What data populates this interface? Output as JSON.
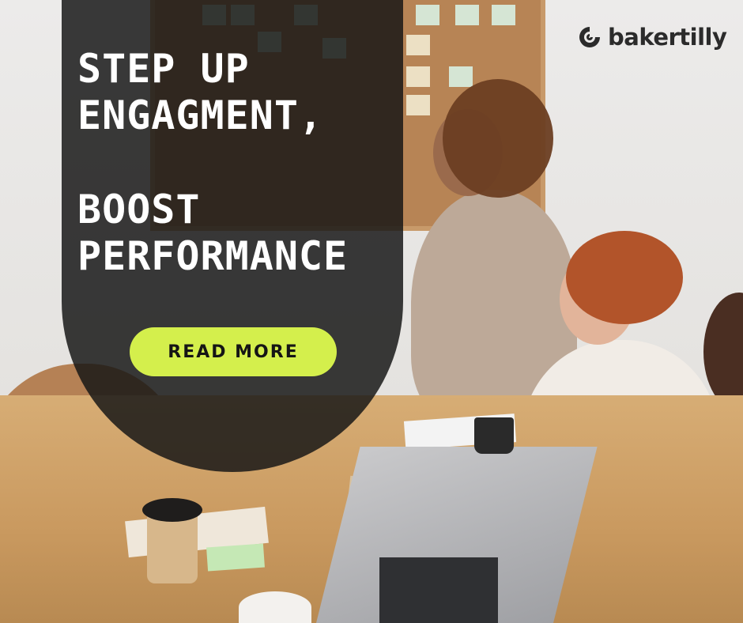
{
  "headline": {
    "line1": "STEP UP",
    "line2": "ENGAGMENT,",
    "line3": "BOOST",
    "line4": "PERFORMANCE"
  },
  "cta": {
    "label": "READ MORE"
  },
  "brand": {
    "name": "bakertilly",
    "logo_icon": "bakertilly-swirl-icon"
  },
  "colors": {
    "cta_background": "#d4ef4c",
    "panel_overlay": "#161616",
    "headline_text": "#ffffff",
    "logo_text": "#2b2b2b"
  }
}
